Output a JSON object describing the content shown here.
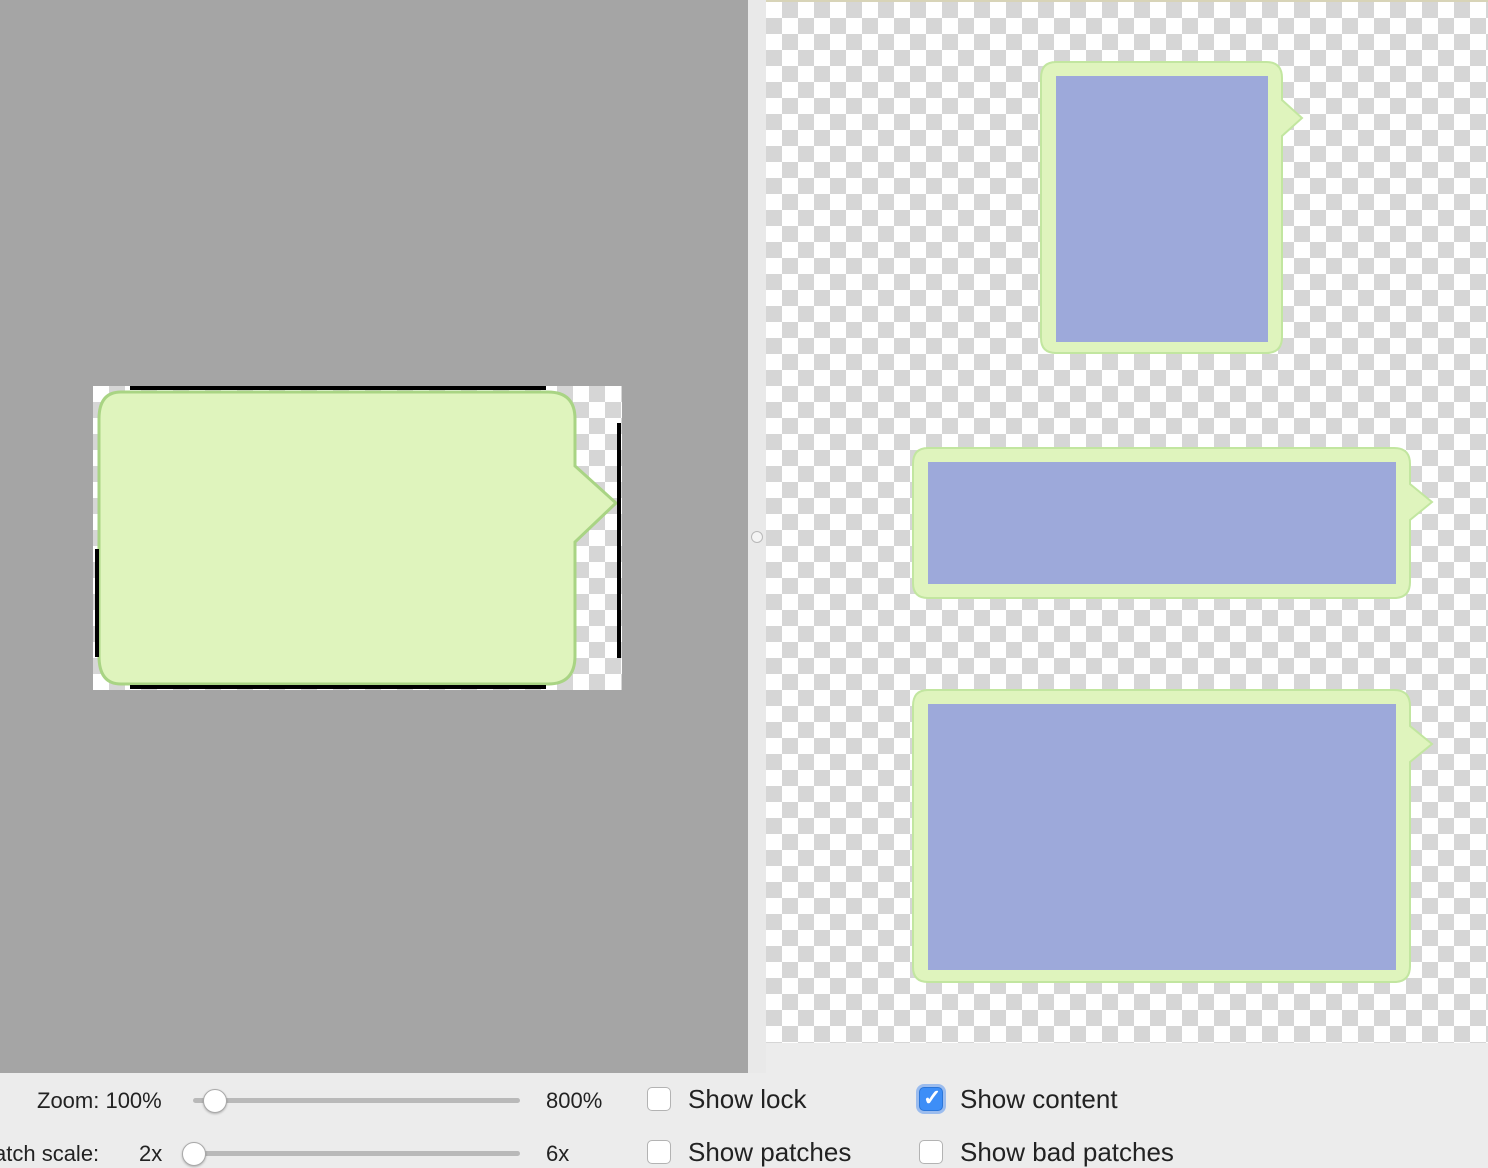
{
  "editor": {
    "source_image": "speech-bubble-ninepatch",
    "bubble_fill": "#dff4bd",
    "bubble_stroke": "#a9d484",
    "patch_marker_color": "#000000"
  },
  "preview": {
    "content_fill": "#9da9da",
    "bubble_fill": "#dff4bd",
    "bubble_stroke": "#c2e6a0",
    "items": [
      "preview-vertical-stretch",
      "preview-horizontal-stretch",
      "preview-both-stretch"
    ]
  },
  "controls": {
    "zoom": {
      "label": "Zoom: 100%",
      "max_label": "800%",
      "value_fraction": 0.03
    },
    "patch_scale": {
      "label": "atch scale:",
      "value_label": "2x",
      "max_label": "6x",
      "value_fraction": 0.0
    },
    "options": [
      {
        "label": "Show lock",
        "checked": false
      },
      {
        "label": "Show content",
        "checked": true
      },
      {
        "label": "Show patches",
        "checked": false
      },
      {
        "label": "Show bad patches",
        "checked": false
      }
    ]
  }
}
